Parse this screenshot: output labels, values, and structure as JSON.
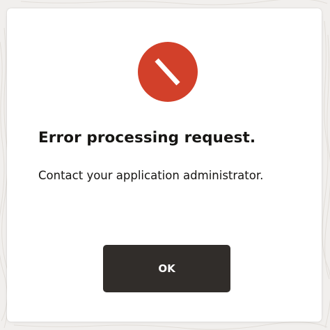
{
  "dialog": {
    "icon": "error-icon",
    "title": "Error processing request.",
    "message": "Contact your application administrator.",
    "ok_label": "OK"
  },
  "colors": {
    "error_red": "#d2402a",
    "button_bg": "#312d2a",
    "text": "#161513",
    "background": "#f1efed"
  }
}
